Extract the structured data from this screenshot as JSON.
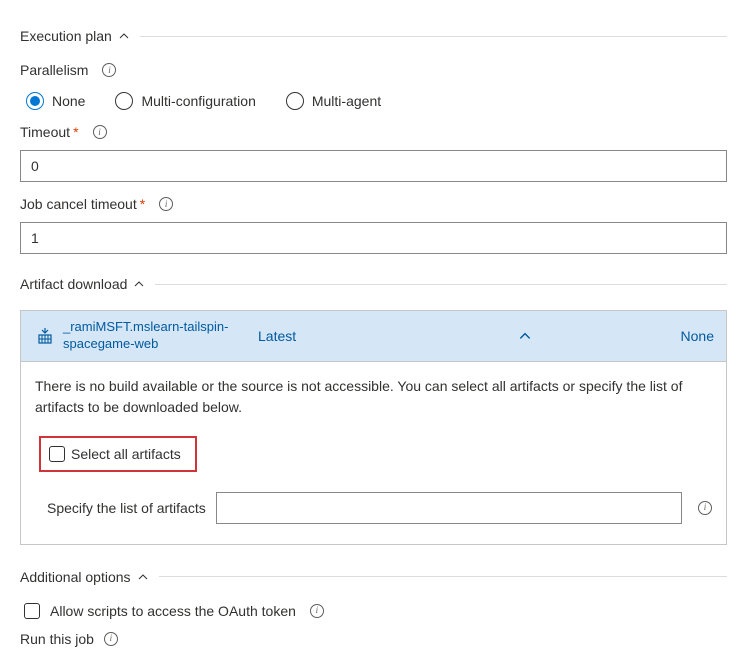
{
  "sections": {
    "execution": "Execution plan",
    "artifact": "Artifact download",
    "additional": "Additional options"
  },
  "parallelism": {
    "label": "Parallelism",
    "options": {
      "none": "None",
      "multiConfig": "Multi-configuration",
      "multiAgent": "Multi-agent"
    }
  },
  "timeout": {
    "label": "Timeout",
    "value": "0"
  },
  "jobCancel": {
    "label": "Job cancel timeout",
    "value": "1"
  },
  "artifact": {
    "name": "_ramiMSFT.mslearn-tailspin-spacegame-web",
    "latest": "Latest",
    "none": "None",
    "message": "There is no build available or the source is not accessible. You can select all artifacts or specify the list of artifacts to be downloaded below.",
    "selectAll": "Select all artifacts",
    "specifyLabel": "Specify the list of artifacts",
    "specifyValue": ""
  },
  "allowScripts": "Allow scripts to access the OAuth token",
  "runThisJob": "Run this job"
}
